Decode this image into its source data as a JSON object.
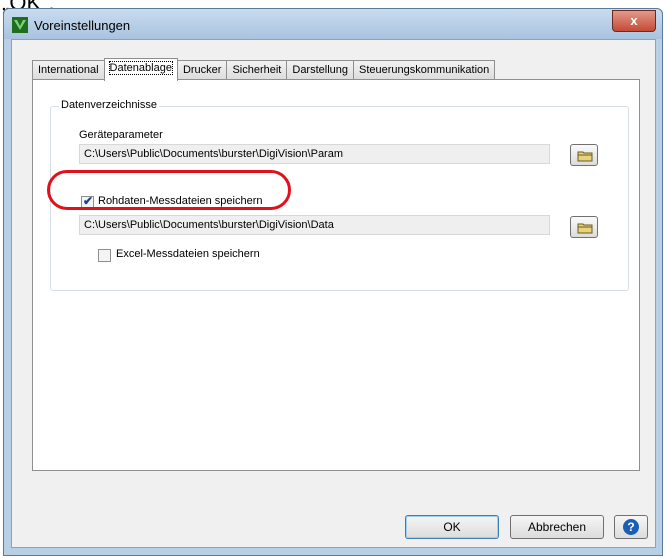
{
  "above_text": "„OK“.",
  "window": {
    "title": "Voreinstellungen",
    "close_glyph": "x"
  },
  "tabs": [
    {
      "label": "International"
    },
    {
      "label": "Datenablage",
      "active": true
    },
    {
      "label": "Drucker"
    },
    {
      "label": "Sicherheit"
    },
    {
      "label": "Darstellung"
    },
    {
      "label": "Steuerungskommunikation"
    }
  ],
  "group": {
    "label": "Datenverzeichnisse",
    "device_params_label": "Geräteparameter",
    "device_params_path": "C:\\Users\\Public\\Documents\\burster\\DigiVision\\Param",
    "raw_data_checkbox_label": "Rohdaten-Messdateien speichern",
    "raw_data_checked": true,
    "raw_data_path": "C:\\Users\\Public\\Documents\\burster\\DigiVision\\Data",
    "excel_checkbox_label": "Excel-Messdateien speichern",
    "excel_checked": false
  },
  "buttons": {
    "ok": "OK",
    "cancel": "Abbrechen",
    "help_glyph": "?"
  },
  "icons": [
    "app-icon",
    "folder-icon",
    "help-icon",
    "close-icon"
  ],
  "colors": {
    "highlight_oval": "#e0111b",
    "titlebar": "#b9cfe6",
    "app_icon_green": "#2e8b2e"
  }
}
